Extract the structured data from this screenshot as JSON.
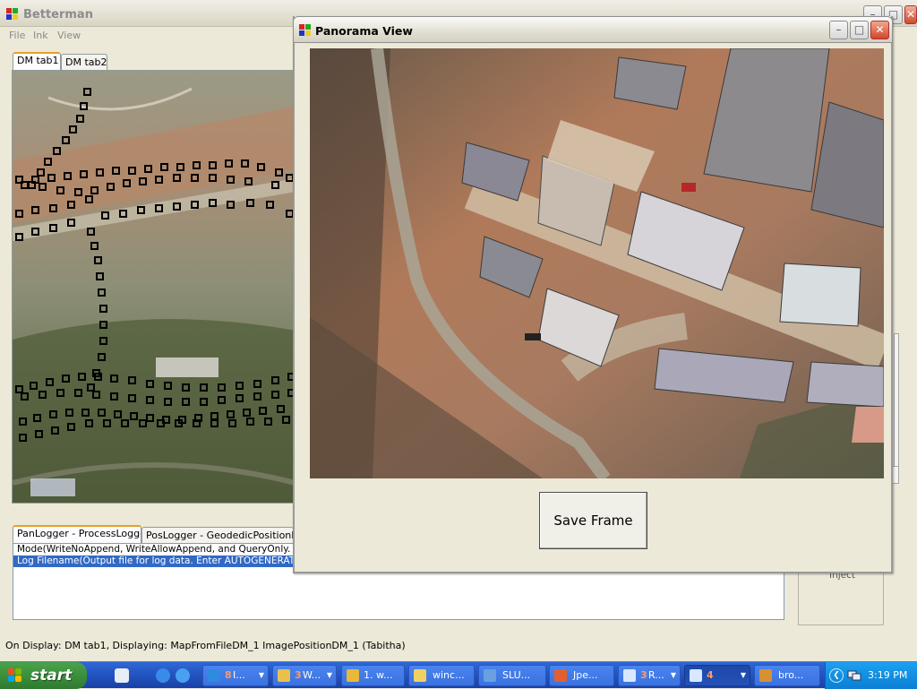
{
  "main_window": {
    "title": "Betterman",
    "menu": [
      "File",
      "Ink",
      "View"
    ],
    "map_tabs": [
      "DM tab1",
      "DM tab2"
    ],
    "log_tabs": [
      "PanLogger - ProcessLogger",
      "PosLogger - GeodedicPositionLog"
    ],
    "log_rows": [
      "Mode(WriteNoAppend, WriteAllowAppend, and QueryOnly. Q",
      "Log Filename(Output file for log data. Enter AUTOGENERAT"
    ],
    "inject_label": "Inject",
    "status": "On Display: DM tab1, Displaying: MapFromFileDM_1 ImagePositionDM_1 (Tabitha)"
  },
  "panorama_window": {
    "title": "Panorama View",
    "save_button": "Save Frame"
  },
  "taskbar": {
    "start_label": "start",
    "buttons": [
      {
        "count": "8",
        "label": "I...",
        "icon_color": "#2f8be0"
      },
      {
        "count": "3",
        "label": "W...",
        "icon_color": "#e8c04a"
      },
      {
        "count": "",
        "label": "1. w...",
        "icon_color": "#e8b838"
      },
      {
        "count": "",
        "label": "winc...",
        "icon_color": "#f0d060"
      },
      {
        "count": "",
        "label": "SLU...",
        "icon_color": "#6aa0e0"
      },
      {
        "count": "",
        "label": "Jpe...",
        "icon_color": "#e06030"
      },
      {
        "count": "3",
        "label": "R...",
        "icon_color": "#d8e8ff"
      },
      {
        "count": "",
        "label": "bro...",
        "icon_color": "#d89030"
      }
    ],
    "active_button": {
      "count": "4"
    },
    "clock": "3:19 PM"
  },
  "colors": {
    "selection": "#3169c6",
    "taskbar": "#2457c5",
    "start": "#3c8f3c",
    "tray": "#1290e2"
  }
}
